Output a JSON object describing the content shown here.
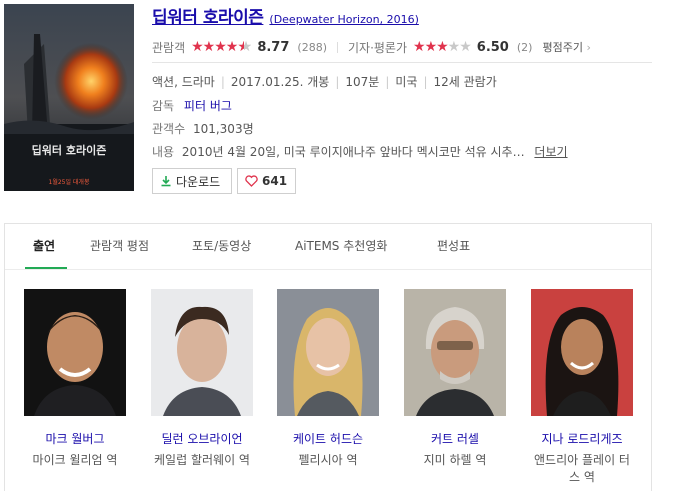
{
  "movie": {
    "title": "딥워터 호라이즌",
    "original_title": "(Deepwater Horizon, 2016)",
    "poster_title": "딥워터 호라이즌",
    "poster_release_badge": "1월25일 대개봉",
    "audience_rating": {
      "label": "관람객",
      "score": "8.77",
      "count": "(288)",
      "stars": 4.5
    },
    "critic_rating": {
      "label": "기자·평론가",
      "score": "6.50",
      "count": "(2)",
      "stars": 3
    },
    "rate_link": "평점주기",
    "genre": "액션, 드라마",
    "release_date": "2017.01.25. 개봉",
    "runtime": "107분",
    "country": "미국",
    "age_rating": "12세 관람가",
    "director_label": "감독",
    "director": "피터 버그",
    "audience_label": "관객수",
    "audience_count": "101,303명",
    "plot_label": "내용",
    "plot": "2010년 4월 20일, 미국 루이지애나주 앞바다 멕시코만 석유 시추…",
    "plot_more": "더보기",
    "download_label": "다운로드",
    "like_count": "641"
  },
  "tabs": [
    {
      "label": "출연",
      "active": true
    },
    {
      "label": "관람객 평점",
      "active": false
    },
    {
      "label": "포토/동영상",
      "active": false
    },
    {
      "label": "AiTEMS 추천영화",
      "active": false
    },
    {
      "label": "편성표",
      "active": false
    }
  ],
  "cast": [
    {
      "name": "마크 월버그",
      "role": "마이크 윌리엄 역"
    },
    {
      "name": "딜런 오브라이언",
      "role": "케일럽 할러웨이 역"
    },
    {
      "name": "케이트 허드슨",
      "role": "펠리시아 역"
    },
    {
      "name": "커트 러셀",
      "role": "지미 하렐 역"
    },
    {
      "name": "지나 로드리게즈",
      "role": "앤드리아 플레이 터스 역"
    }
  ],
  "colors": {
    "star": "#e0334d",
    "link": "#1a0dab",
    "tab_accent": "#22aa55"
  }
}
